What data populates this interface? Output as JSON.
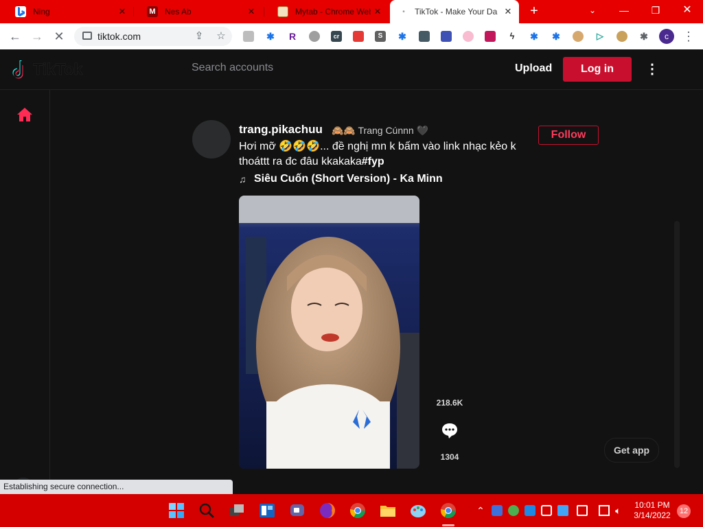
{
  "browser": {
    "tabs": [
      {
        "title": "Ning",
        "active": false
      },
      {
        "title": "Nes Ab",
        "active": false
      },
      {
        "title": "Mytab - Chrome Web",
        "active": false
      },
      {
        "title": "TikTok - Make Your Da",
        "active": true
      }
    ],
    "url": "tiktok.com",
    "profile_initial": "c",
    "new_tab_symbol": "+"
  },
  "tiktok": {
    "logo_text": "TikTok",
    "search_placeholder": "Search accounts",
    "upload_label": "Upload",
    "login_label": "Log in",
    "post": {
      "username": "trang.pikachuu",
      "nickname": "🙈🙈 Trang Cúnnn 🖤",
      "caption": "Hơi mỡ 🤣🤣🤣... đề nghị mn k bấm vào link nhạc kẻo k thoáttt ra đc đâu kkakaka",
      "hashtag": "#fyp",
      "music": "Siêu Cuốn (Short Version) - Ka Minn",
      "follow_label": "Follow",
      "like_count": "218.6K",
      "comment_count": "1304"
    },
    "get_app_label": "Get app"
  },
  "status_text": "Establishing secure connection...",
  "taskbar": {
    "time": "10:01 PM",
    "date": "3/14/2022",
    "notification_count": "12"
  },
  "colors": {
    "tab_strip": "#e60000",
    "tiktok_red": "#c8102e",
    "page_bg": "#121212",
    "taskbar": "#d40000"
  }
}
